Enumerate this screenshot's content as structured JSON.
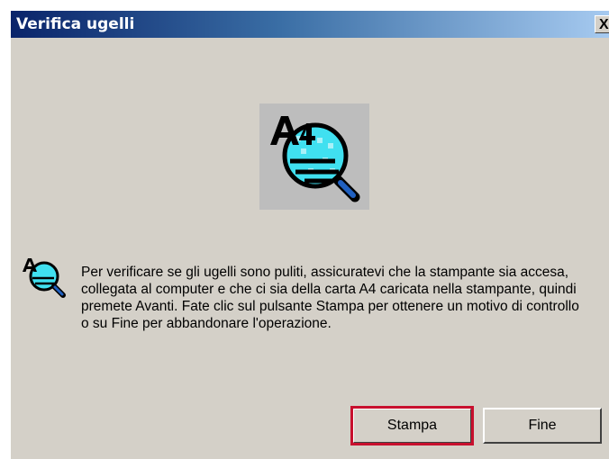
{
  "window": {
    "title": "Verifica ugelli",
    "close_label": "X"
  },
  "icons": {
    "hero": "nozzle-check-magnifier-icon",
    "message": "nozzle-check-magnifier-icon",
    "colors": {
      "lens": "#40e0f0",
      "handle": "#2060c0",
      "ink": "#000000"
    }
  },
  "message": {
    "text": "Per verificare se gli ugelli sono puliti, assicuratevi che la stampante sia accesa, collegata al computer e che ci sia della carta A4 caricata nella stampante, quindi premete Avanti. Fate clic sul pulsante Stampa per ottenere un motivo di controllo o su Fine per abbandonare l'operazione."
  },
  "buttons": {
    "print": "Stampa",
    "finish": "Fine"
  },
  "highlight_color": "#c8102e"
}
